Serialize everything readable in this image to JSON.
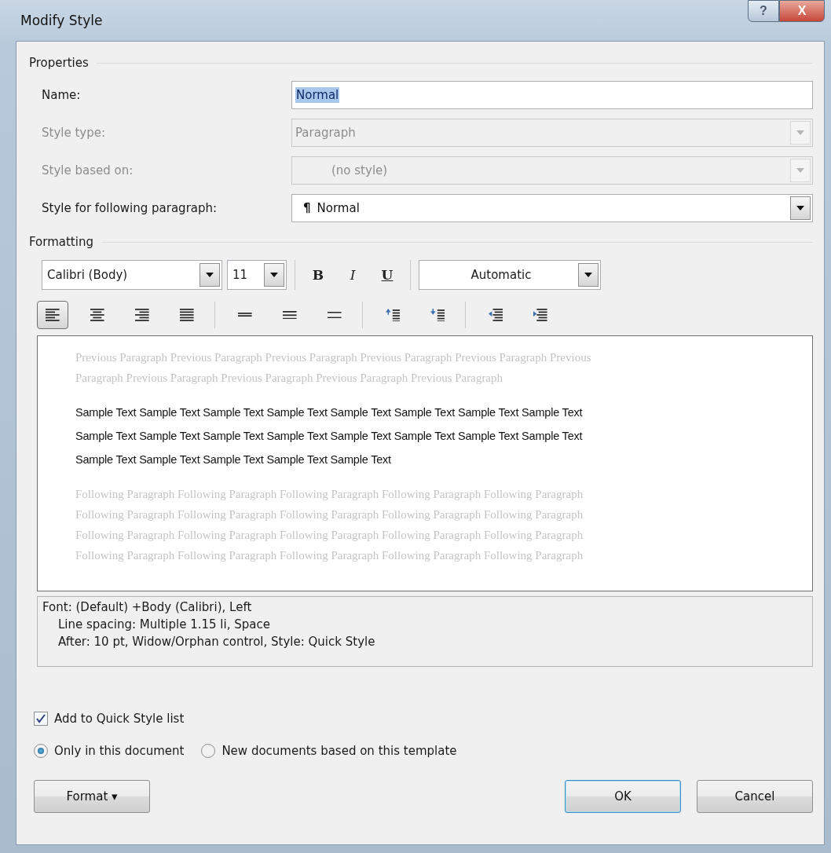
{
  "window": {
    "title": "Modify Style",
    "buttons": [
      {
        "kind": "help",
        "label": "?"
      },
      {
        "kind": "close",
        "label": "X"
      }
    ]
  },
  "properties": {
    "title": "Properties",
    "fields": [
      {
        "kind": "text",
        "label": "Name:",
        "value": "Normal",
        "disabled": false
      },
      {
        "kind": "select",
        "label": "Style type:",
        "value": "Paragraph",
        "disabled": true
      },
      {
        "kind": "select",
        "label": "Style based on:",
        "value": "(no style)",
        "disabled": true
      },
      {
        "kind": "select",
        "label": "Style for following paragraph:",
        "value": "Normal",
        "mark": "¶",
        "disabled": false
      }
    ]
  },
  "formatting": {
    "title": "Formatting",
    "font": "Calibri (Body)",
    "size": "11",
    "styles": [
      {
        "kind": "bold",
        "label": "B",
        "selected": false
      },
      {
        "kind": "italic",
        "label": "I",
        "selected": false
      },
      {
        "kind": "underline",
        "label": "U",
        "selected": false
      }
    ],
    "font_color": "Automatic",
    "tool_groups": [
      [
        {
          "kind": "align-left",
          "selected": true
        },
        {
          "kind": "align-center",
          "selected": false
        },
        {
          "kind": "align-right",
          "selected": false
        },
        {
          "kind": "justify",
          "selected": false
        }
      ],
      [
        {
          "kind": "single",
          "selected": false
        },
        {
          "kind": "one-half",
          "selected": false
        },
        {
          "kind": "double",
          "selected": false
        }
      ],
      [
        {
          "kind": "space-before",
          "selected": false
        },
        {
          "kind": "space-after",
          "selected": false
        }
      ],
      [
        {
          "kind": "outdent",
          "selected": false
        },
        {
          "kind": "indent",
          "selected": false
        }
      ]
    ]
  },
  "preview": {
    "previous": [
      "Previous Paragraph Previous Paragraph Previous Paragraph Previous Paragraph Previous Paragraph Previous",
      "Paragraph Previous Paragraph Previous Paragraph Previous Paragraph Previous Paragraph"
    ],
    "sample": [
      "Sample Text Sample Text Sample Text Sample Text Sample Text Sample Text Sample Text Sample Text",
      "Sample Text Sample Text Sample Text Sample Text Sample Text Sample Text Sample Text Sample Text",
      "Sample Text Sample Text Sample Text Sample Text Sample Text"
    ],
    "following": [
      "Following Paragraph Following Paragraph Following Paragraph Following Paragraph Following Paragraph",
      "Following Paragraph Following Paragraph Following Paragraph Following Paragraph Following Paragraph",
      "Following Paragraph Following Paragraph Following Paragraph Following Paragraph Following Paragraph",
      "Following Paragraph Following Paragraph Following Paragraph Following Paragraph Following Paragraph"
    ]
  },
  "description": [
    "Font: (Default) +Body (Calibri), Left",
    "Line spacing:  Multiple 1.15 li, Space",
    "After:  10 pt, Widow/Orphan control, Style: Quick Style"
  ],
  "add_to_quick_style": {
    "label": "Add to Quick Style list",
    "checked": true
  },
  "scope": [
    {
      "label": "Only in this document",
      "selected": true
    },
    {
      "label": "New documents based on this template",
      "selected": false
    }
  ],
  "buttons": [
    {
      "kind": "menu",
      "label": "Format",
      "caret": "▾"
    },
    {
      "kind": "default",
      "label": "OK"
    },
    {
      "kind": "plain",
      "label": "Cancel"
    }
  ]
}
